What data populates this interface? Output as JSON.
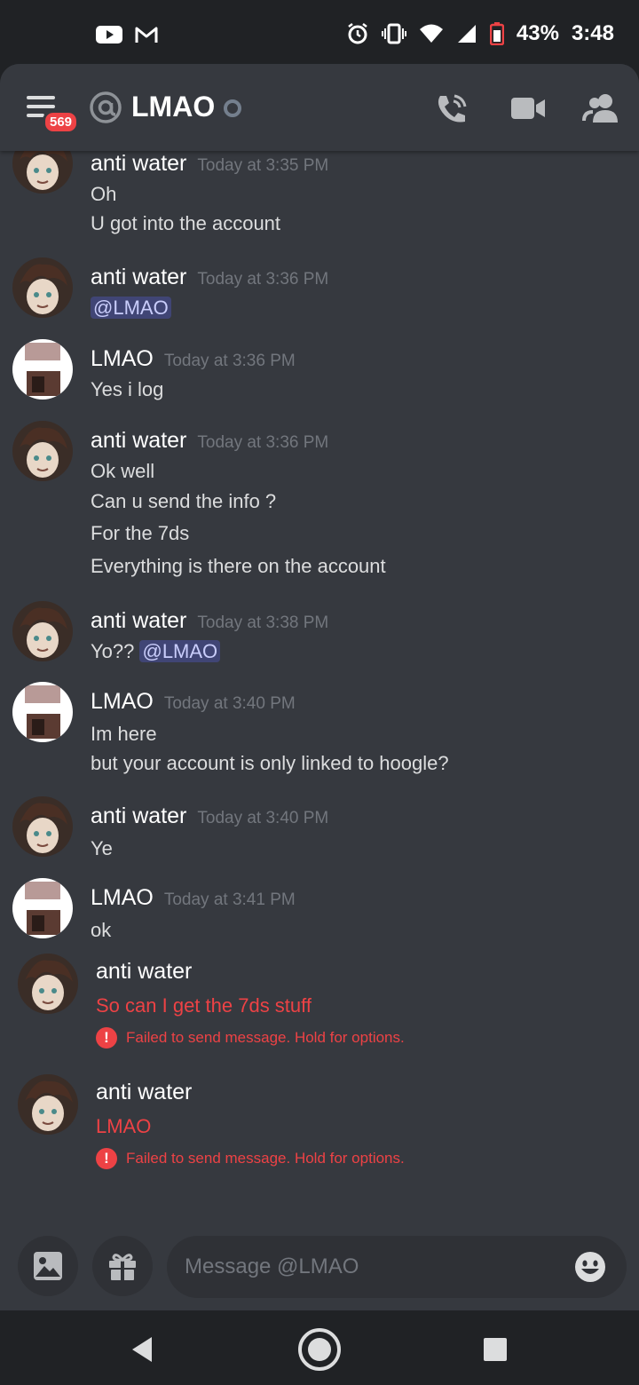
{
  "status_bar": {
    "battery": "43%",
    "time": "3:48",
    "icons": [
      "youtube-icon",
      "gmail-icon",
      "alarm-icon",
      "vibrate-icon",
      "wifi-icon",
      "signal-icon",
      "battery-icon"
    ]
  },
  "header": {
    "unread_badge": "569",
    "channel_name": "LMAO",
    "icons": [
      "menu-icon",
      "at-icon",
      "status-offline-icon",
      "call-icon",
      "video-icon",
      "members-icon"
    ]
  },
  "messages": [
    {
      "author": "anti water",
      "timestamp": "Today at 3:35 PM",
      "lines": [
        "Oh",
        "U got into the account"
      ]
    },
    {
      "author": "anti water",
      "timestamp": "Today at 3:36 PM",
      "mention": "@LMAO"
    },
    {
      "author": "LMAO",
      "timestamp": "Today at 3:36 PM",
      "lines": [
        "Yes i log"
      ]
    },
    {
      "author": "anti water",
      "timestamp": "Today at 3:36 PM",
      "lines": [
        "Ok well",
        "Can u send the info ?",
        "For the 7ds",
        "Everything is there on the account"
      ]
    },
    {
      "author": "anti water",
      "timestamp": "Today at 3:38 PM",
      "text_before_mention": "Yo?? ",
      "mention": "@LMAO"
    },
    {
      "author": "LMAO",
      "timestamp": "Today at 3:40 PM",
      "lines": [
        "Im here",
        "but your account is only linked to hoogle?"
      ]
    },
    {
      "author": "anti water",
      "timestamp": "Today at 3:40 PM",
      "lines": [
        "Ye"
      ]
    },
    {
      "author": "LMAO",
      "timestamp": "Today at 3:41 PM",
      "lines": [
        "ok"
      ]
    },
    {
      "author": "anti water",
      "failed_text": "So can I get the 7ds stuff",
      "failed_note": "Failed to send message. Hold for options."
    },
    {
      "author": "anti water",
      "failed_text": "LMAO",
      "failed_note": "Failed to send message. Hold for options."
    }
  ],
  "composer": {
    "placeholder": "Message @LMAO",
    "icons": [
      "image-icon",
      "gift-icon",
      "emoji-icon"
    ]
  },
  "colors": {
    "background": "#36393f",
    "header_bar": "#202225",
    "error": "#ed4245",
    "mention": "#c9cdfb",
    "timestamp": "#72767d"
  }
}
